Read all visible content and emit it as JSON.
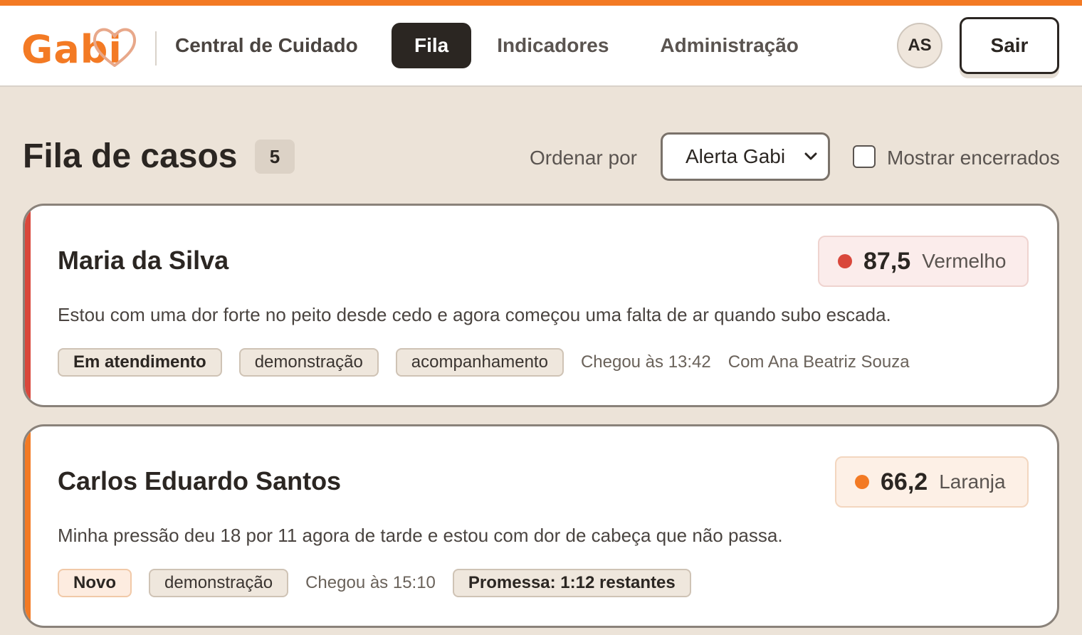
{
  "colors": {
    "accent": "#f37a24",
    "red": "#d9473b",
    "orange": "#f37a24",
    "dark": "#2b2622"
  },
  "header": {
    "logo_text": "Gabi",
    "app_name": "Central de Cuidado",
    "nav": [
      {
        "label": "Fila",
        "active": true
      },
      {
        "label": "Indicadores",
        "active": false
      },
      {
        "label": "Administração",
        "active": false
      }
    ],
    "avatar_initials": "AS",
    "logout_label": "Sair"
  },
  "main": {
    "title": "Fila de casos",
    "count": "5",
    "sort_label": "Ordenar por",
    "sort_selected": "Alerta Gabi",
    "show_closed_label": "Mostrar encerrados",
    "show_closed_checked": false
  },
  "cases": [
    {
      "name": "Maria da Silva",
      "score": "87,5",
      "level": "Vermelho",
      "message": "Estou com uma dor forte no peito desde cedo e agora começou uma falta de ar quando subo escada.",
      "status": "Em atendimento",
      "tags": [
        "demonstração",
        "acompanhamento"
      ],
      "arrived": "Chegou às 13:42",
      "assignee": "Com Ana Beatriz Souza"
    },
    {
      "name": "Carlos Eduardo Santos",
      "score": "66,2",
      "level": "Laranja",
      "message": "Minha pressão deu 18 por 11 agora de tarde e estou com dor de cabeça que não passa.",
      "status": "Novo",
      "tags": [
        "demonstração"
      ],
      "arrived": "Chegou às 15:10",
      "promise": "Promessa: 1:12 restantes"
    }
  ]
}
